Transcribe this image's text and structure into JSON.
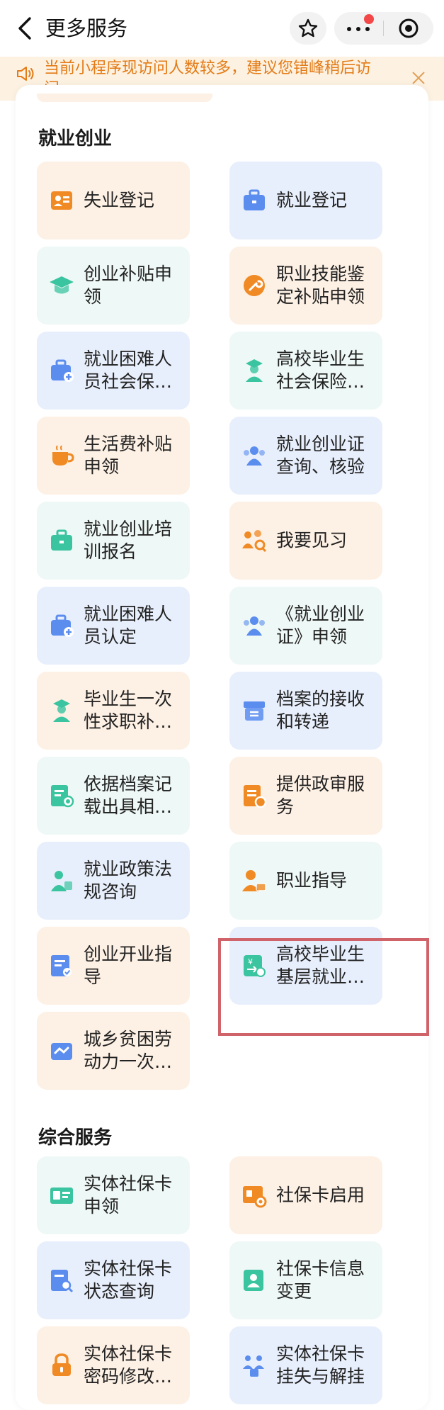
{
  "nav": {
    "title": "更多服务"
  },
  "notice": {
    "text": "当前小程序现访问人数较多，建议您错峰稍后访问。"
  },
  "colors": {
    "accent_orange": "#f08a24",
    "accent_blue": "#5b8def",
    "accent_green": "#3bc4a0",
    "highlight_border": "#d0626a"
  },
  "sections": [
    {
      "title": "就业创业",
      "tiles": [
        {
          "label": "失业登记",
          "icon": "id-card-icon"
        },
        {
          "label": "就业登记",
          "icon": "briefcase-icon"
        },
        {
          "label": "创业补贴申领",
          "icon": "graduation-cap-icon"
        },
        {
          "label": "职业技能鉴定补贴申领",
          "icon": "wrench-icon"
        },
        {
          "label": "就业困难人员社会保险补…",
          "icon": "briefcase-plus-icon"
        },
        {
          "label": "高校毕业生社会保险补贴…",
          "icon": "graduate-person-icon"
        },
        {
          "label": "生活费补贴申领",
          "icon": "cup-icon"
        },
        {
          "label": "就业创业证查询、核验",
          "icon": "people-icon"
        },
        {
          "label": "就业创业培训报名",
          "icon": "briefcase-icon"
        },
        {
          "label": "我要见习",
          "icon": "group-search-icon"
        },
        {
          "label": "就业困难人员认定",
          "icon": "briefcase-plus-icon"
        },
        {
          "label": "《就业创业证》申领",
          "icon": "people-icon"
        },
        {
          "label": "毕业生一次性求职补贴申领",
          "icon": "graduate-person-icon"
        },
        {
          "label": "档案的接收和转递",
          "icon": "archive-box-icon"
        },
        {
          "label": "依据档案记载出具相关证明",
          "icon": "certificate-icon"
        },
        {
          "label": "提供政审服务",
          "icon": "document-badge-icon"
        },
        {
          "label": "就业政策法规咨询",
          "icon": "person-policy-icon"
        },
        {
          "label": "职业指导",
          "icon": "person-card-icon"
        },
        {
          "label": "创业开业指导",
          "icon": "document-check-icon"
        },
        {
          "label": "高校毕业生基层就业补贴…",
          "icon": "yuan-transfer-icon"
        },
        {
          "label": "城乡贫困劳动力一次性求…",
          "icon": "handshake-icon"
        }
      ]
    },
    {
      "title": "综合服务",
      "tiles": [
        {
          "label": "实体社保卡申领",
          "icon": "social-card-icon"
        },
        {
          "label": "社保卡启用",
          "icon": "card-gear-icon"
        },
        {
          "label": "实体社保卡状态查询",
          "icon": "document-search-icon"
        },
        {
          "label": "社保卡信息变更",
          "icon": "person-edit-icon"
        },
        {
          "label": "实体社保卡密码修改与重置",
          "icon": "lock-icon"
        },
        {
          "label": "实体社保卡挂失与解挂",
          "icon": "people-lock-icon"
        }
      ]
    }
  ]
}
